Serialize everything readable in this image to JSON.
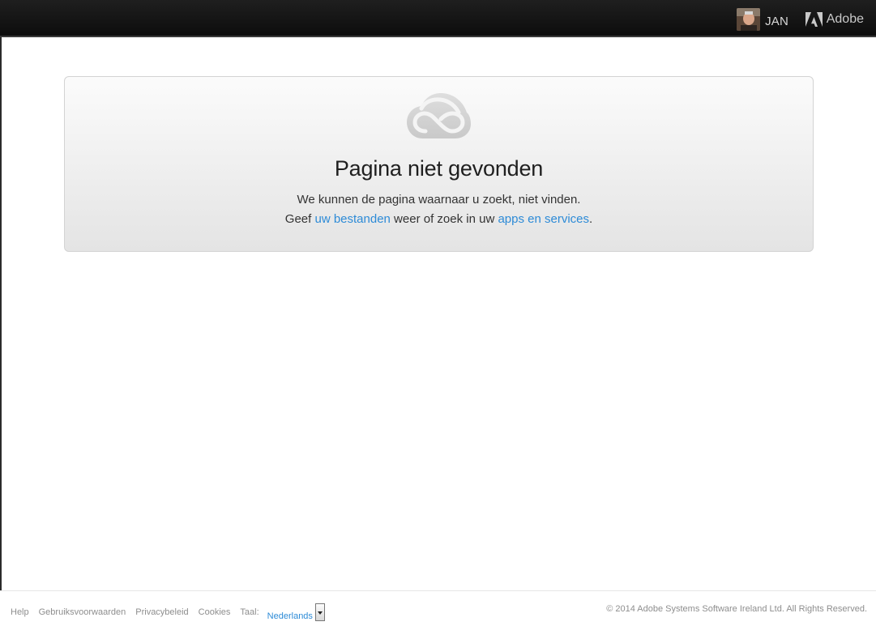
{
  "header": {
    "user_name": "JAN",
    "brand": "Adobe"
  },
  "error": {
    "icon": "creative-cloud-icon",
    "title": "Pagina niet gevonden",
    "line1": "We kunnen de pagina waarnaar u zoekt, niet vinden.",
    "line2_prefix": "Geef ",
    "files_link": "uw bestanden",
    "line2_middle": " weer of zoek in uw ",
    "apps_link": "apps en services",
    "line2_suffix": "."
  },
  "footer": {
    "help": "Help",
    "terms": "Gebruiksvoorwaarden",
    "privacy": "Privacybeleid",
    "cookies": "Cookies",
    "language_label": "Taal:",
    "language_value": "Nederlands",
    "copyright": "© 2014 Adobe Systems Software Ireland Ltd. All Rights Reserved."
  },
  "colors": {
    "link": "#2d8bd7",
    "header_bg": "#111111"
  }
}
